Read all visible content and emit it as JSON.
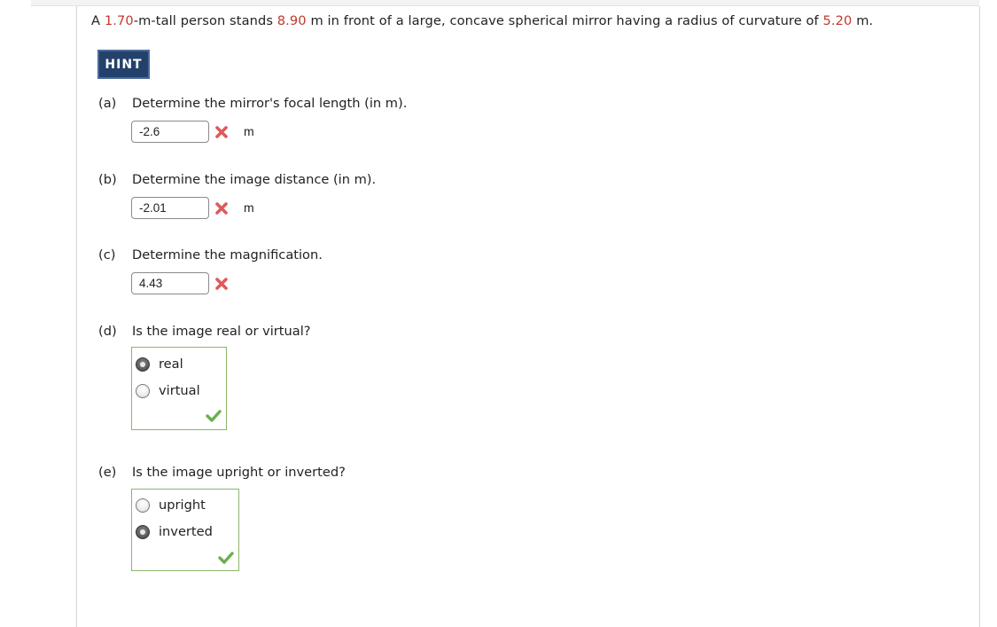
{
  "problem": {
    "prefix": "A ",
    "height_value": "1.70",
    "part2": "-m-tall person stands ",
    "distance_value": "8.90",
    "part3": " m in front of a large, concave spherical mirror having a radius of curvature of ",
    "radius_value": "5.20",
    "suffix": " m."
  },
  "hint_button": {
    "label": "HINT",
    "color": "#23416a"
  },
  "colors": {
    "value_highlight": "#c0392b",
    "incorrect": "#e05a5a",
    "correct": "#6ab04c",
    "correct_border": "#8cb66a"
  },
  "questions": [
    {
      "letter": "(a)",
      "text": "Determine the mirror's focal length (in m).",
      "answer": "-2.6",
      "unit": "m",
      "status": "incorrect",
      "status_icon": "x-icon"
    },
    {
      "letter": "(b)",
      "text": "Determine the image distance (in m).",
      "answer": "-2.01",
      "unit": "m",
      "status": "incorrect",
      "status_icon": "x-icon"
    },
    {
      "letter": "(c)",
      "text": "Determine the magnification.",
      "answer": "4.43",
      "unit": "",
      "status": "incorrect",
      "status_icon": "x-icon"
    },
    {
      "letter": "(d)",
      "text": "Is the image real or virtual?",
      "options": [
        "real",
        "virtual"
      ],
      "selected": "real",
      "status": "correct",
      "status_icon": "check-icon"
    },
    {
      "letter": "(e)",
      "text": "Is the image upright or inverted?",
      "options": [
        "upright",
        "inverted"
      ],
      "selected": "inverted",
      "status": "correct",
      "status_icon": "check-icon"
    }
  ]
}
